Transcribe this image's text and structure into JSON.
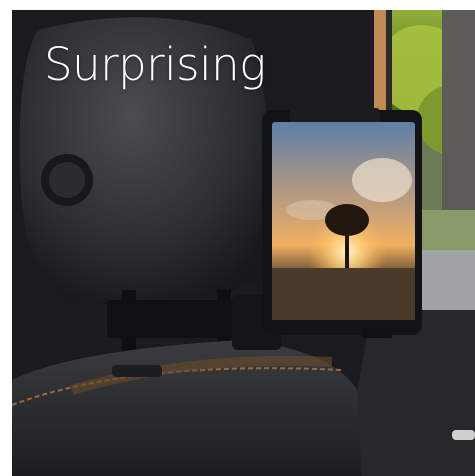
{
  "headline": "Surprising"
}
